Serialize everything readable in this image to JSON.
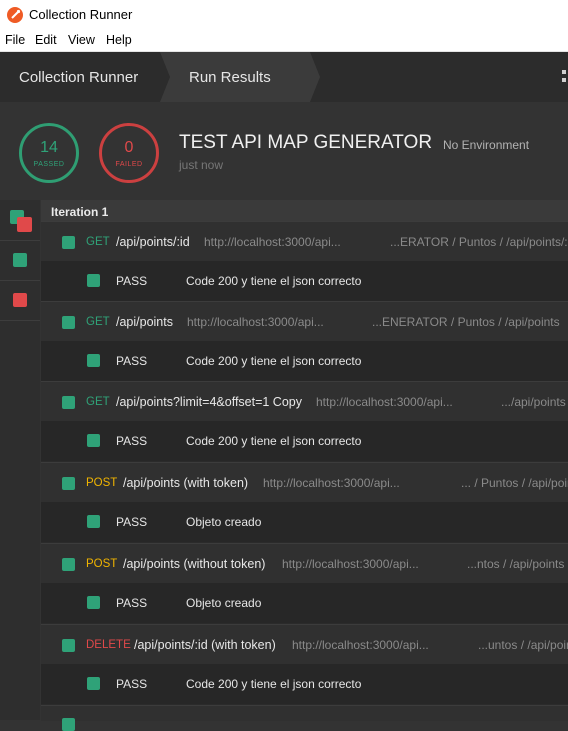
{
  "window": {
    "title": "Collection Runner"
  },
  "menu": [
    "File",
    "Edit",
    "View",
    "Help"
  ],
  "header": {
    "crumb1": "Collection Runner",
    "crumb2": "Run Results"
  },
  "summary": {
    "passed_count": "14",
    "passed_label": "PASSED",
    "failed_count": "0",
    "failed_label": "FAILED",
    "collection_name": "TEST API MAP GENERATOR",
    "environment": "No Environment",
    "time": "just now"
  },
  "iteration": {
    "label": "Iteration 1"
  },
  "requests": [
    {
      "method": "GET",
      "path": "/api/points/:id",
      "url": "http://localhost:3000/api...",
      "crumb": "...ERATOR / Puntos / /api/points/:id",
      "test": {
        "status": "PASS",
        "name": "Code 200 y tiene el json correcto"
      }
    },
    {
      "method": "GET",
      "path": "/api/points",
      "url": "http://localhost:3000/api...",
      "crumb": "...ENERATOR / Puntos / /api/points",
      "test": {
        "status": "PASS",
        "name": "Code 200 y tiene el json correcto"
      }
    },
    {
      "method": "GET",
      "path": "/api/points?limit=4&offset=1 Copy",
      "url": "http://localhost:3000/api...",
      "crumb": ".../api/points",
      "test": {
        "status": "PASS",
        "name": "Code 200 y tiene el json correcto"
      }
    },
    {
      "method": "POST",
      "path": "/api/points (with token)",
      "url": "http://localhost:3000/api...",
      "crumb": "... / Puntos / /api/points",
      "test": {
        "status": "PASS",
        "name": "Objeto creado"
      }
    },
    {
      "method": "POST",
      "path": "/api/points (without token)",
      "url": "http://localhost:3000/api...",
      "crumb": "...ntos / /api/points",
      "test": {
        "status": "PASS",
        "name": "Objeto creado"
      }
    },
    {
      "method": "DELETE",
      "path": "/api/points/:id (with token)",
      "url": "http://localhost:3000/api...",
      "crumb": "...untos / /api/points",
      "test": {
        "status": "PASS",
        "name": "Code 200 y tiene el json correcto"
      }
    }
  ],
  "colors": {
    "pass": "#2fa278",
    "fail": "#e0494a",
    "get": "#2fa278",
    "post": "#f0b400",
    "delete": "#e0494a"
  }
}
